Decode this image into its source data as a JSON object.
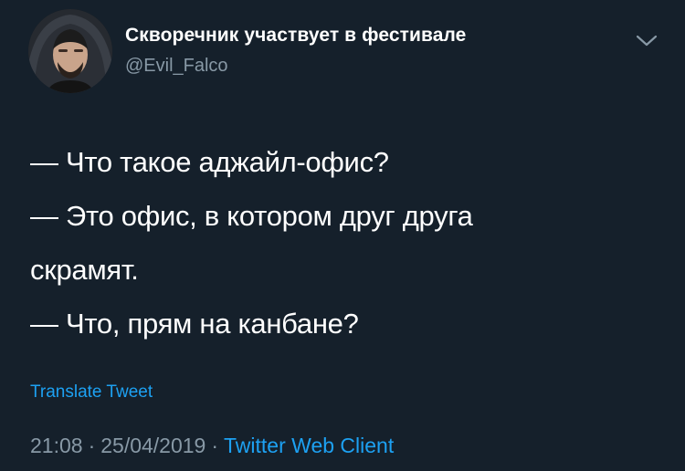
{
  "tweet": {
    "display_name": "Скворечник участвует в фестивале",
    "handle": "@Evil_Falco",
    "text_lines": [
      "— Что такое аджайл-офис?",
      "— Это офис, в котором друг друга",
      "скрамят.",
      "— Что, прям на канбане?"
    ],
    "translate_label": "Translate Tweet",
    "time": "21:08",
    "date": "25/04/2019",
    "separator": "·",
    "source": "Twitter Web Client"
  },
  "colors": {
    "background": "#15202b",
    "text": "#ffffff",
    "secondary_text": "#8899a6",
    "accent": "#1da1f2"
  },
  "icons": {
    "menu": "chevron-down-icon"
  }
}
